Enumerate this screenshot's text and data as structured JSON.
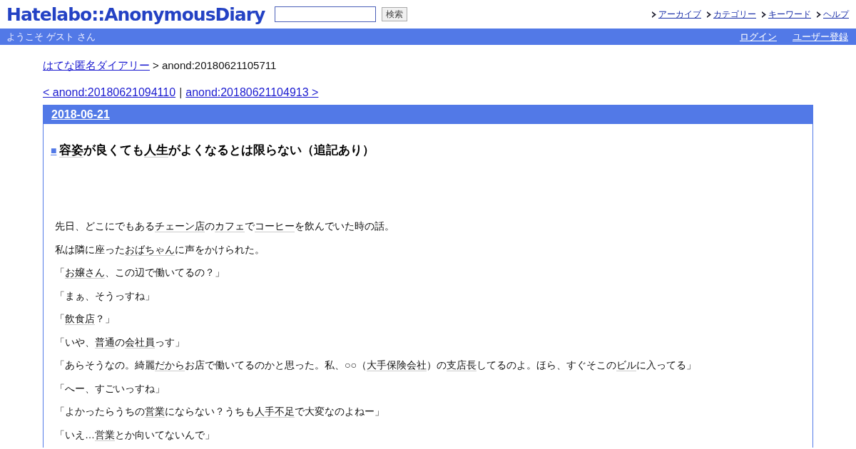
{
  "header": {
    "logo": "Hatelabo::AnonymousDiary",
    "search": {
      "button": "検索"
    },
    "nav": [
      "アーカイブ",
      "カテゴリー",
      "キーワード",
      "ヘルプ"
    ]
  },
  "user_bar": {
    "welcome": "ようこそ ゲスト さん",
    "links": [
      "ログイン",
      "ユーザー登録"
    ]
  },
  "breadcrumb": {
    "link": "はてな匿名ダイアリー",
    "current": "> anond:20180621105711"
  },
  "pager": {
    "prev": "< anond:20180621094110",
    "separator": "|",
    "next": "anond:20180621104913 >"
  },
  "day": {
    "date": "2018-06-21",
    "title_mark": "■",
    "title": [
      {
        "text": "容姿",
        "keyword": true
      },
      {
        "text": "が良くても",
        "keyword": false
      },
      {
        "text": "人生",
        "keyword": true
      },
      {
        "text": "がよくなるとは限らない（追記あり）",
        "keyword": false
      }
    ],
    "paragraphs": [
      [
        {
          "text": "先日、どこにでもある",
          "keyword": false
        },
        {
          "text": "チェーン店",
          "keyword": true
        },
        {
          "text": "の",
          "keyword": false
        },
        {
          "text": "カフェ",
          "keyword": true
        },
        {
          "text": "で",
          "keyword": false
        },
        {
          "text": "コーヒー",
          "keyword": true
        },
        {
          "text": "を飲んでいた時の話。",
          "keyword": false
        }
      ],
      [
        {
          "text": "私は隣に座った",
          "keyword": false
        },
        {
          "text": "おばちゃん",
          "keyword": true
        },
        {
          "text": "に声をかけられた。",
          "keyword": false
        }
      ],
      [
        {
          "text": "「",
          "keyword": false
        },
        {
          "text": "お嬢さん",
          "keyword": true
        },
        {
          "text": "、この辺で働いてるの？」",
          "keyword": false
        }
      ],
      [
        {
          "text": "「まぁ、そうっすね」",
          "keyword": false
        }
      ],
      [
        {
          "text": "「",
          "keyword": false
        },
        {
          "text": "飲食店",
          "keyword": true
        },
        {
          "text": "？」",
          "keyword": false
        }
      ],
      [
        {
          "text": "「いや、",
          "keyword": false
        },
        {
          "text": "普通",
          "keyword": true
        },
        {
          "text": "の",
          "keyword": false
        },
        {
          "text": "会社員",
          "keyword": true
        },
        {
          "text": "っす」",
          "keyword": false
        }
      ],
      [
        {
          "text": "「あらそうなの。綺麗",
          "keyword": false
        },
        {
          "text": "だから",
          "keyword": true
        },
        {
          "text": "お店で働いてるのかと思った。私、○○（",
          "keyword": false
        },
        {
          "text": "大手保険会社",
          "keyword": true
        },
        {
          "text": "）の",
          "keyword": false
        },
        {
          "text": "支店長",
          "keyword": true
        },
        {
          "text": "してるのよ。ほら、すぐそこの",
          "keyword": false
        },
        {
          "text": "ビル",
          "keyword": true
        },
        {
          "text": "に入ってる」",
          "keyword": false
        }
      ],
      [
        {
          "text": "「へー、すごいっすね」",
          "keyword": false
        }
      ],
      [
        {
          "text": "「よかったらうちの",
          "keyword": false
        },
        {
          "text": "営業",
          "keyword": true
        },
        {
          "text": "にならない？うちも",
          "keyword": false
        },
        {
          "text": "人手不足",
          "keyword": true
        },
        {
          "text": "で大変なのよねー」",
          "keyword": false
        }
      ],
      [
        {
          "text": "「いえ…",
          "keyword": false
        },
        {
          "text": "営業",
          "keyword": true
        },
        {
          "text": "とか向いてないんで」",
          "keyword": false
        }
      ]
    ]
  }
}
